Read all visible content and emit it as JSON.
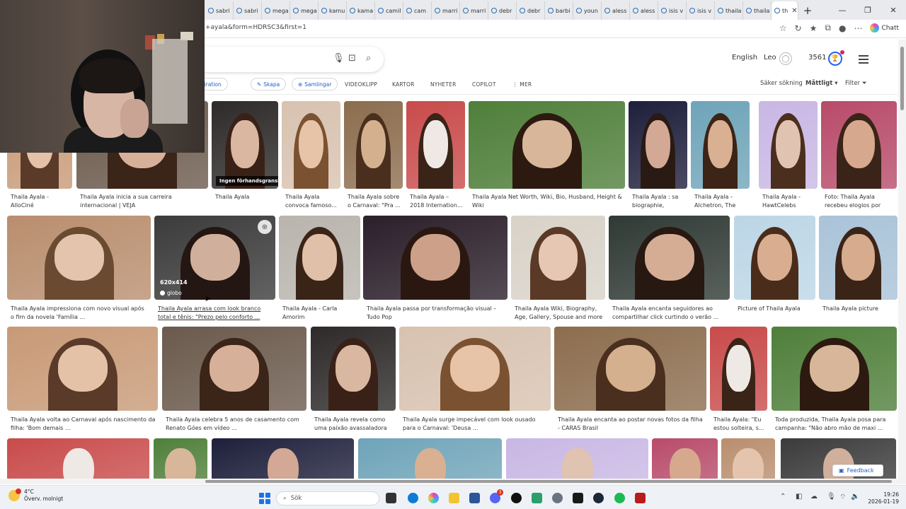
{
  "browser": {
    "tabs": [
      {
        "label": "sabri"
      },
      {
        "label": "sabri"
      },
      {
        "label": "mega"
      },
      {
        "label": "mega"
      },
      {
        "label": "kamu"
      },
      {
        "label": "kama"
      },
      {
        "label": "camil"
      },
      {
        "label": "cam"
      },
      {
        "label": "marri"
      },
      {
        "label": "marri"
      },
      {
        "label": "debr"
      },
      {
        "label": "debr"
      },
      {
        "label": "barbi"
      },
      {
        "label": "youn"
      },
      {
        "label": "aless"
      },
      {
        "label": "aless"
      },
      {
        "label": "isis v"
      },
      {
        "label": "isis v"
      },
      {
        "label": "thaila"
      },
      {
        "label": "thaila"
      },
      {
        "label": "th"
      }
    ],
    "active_tab_close": "✕",
    "new_tab": "+",
    "window_controls": [
      "—",
      "❐",
      "✕"
    ],
    "url": "+ayala&form=HDRSC3&first=1",
    "copilot_label": "Chatt"
  },
  "header": {
    "language": "English",
    "user": "Leo",
    "points": "3561"
  },
  "filters": {
    "chips": [
      "Inspiration",
      "Skapa",
      "Samlingar"
    ],
    "nav": [
      "VIDEOKLIPP",
      "KARTOR",
      "NYHETER",
      "COPILOT",
      "MER"
    ],
    "safe_search": "Säker sökning",
    "safe_level": "Måttligt",
    "filter": "Filter"
  },
  "results": {
    "row1": [
      {
        "caption": "Thaila Ayala - AlloCiné"
      },
      {
        "caption": "Thaila Ayala inicia a sua carreira internacional | VEJA"
      },
      {
        "caption": "Thaila Ayala"
      },
      {
        "caption": "Thaila Ayala convoca famoso..."
      },
      {
        "caption": "Thaila Ayala sobre o Carnaval: \"Pra ..."
      },
      {
        "caption": "Thaila Ayala – 2018 Internation..."
      },
      {
        "caption": "Thaila Ayala Net Worth, Wiki, Bio, Husband, Height & Wiki"
      },
      {
        "caption": "Thaila Ayala : sa biographie, filmo..."
      },
      {
        "caption": "Thaila Ayala - Alchetron, The Fre..."
      },
      {
        "caption": "Thaila Ayala - HawtCelebs"
      },
      {
        "caption": "Foto: Thaila Ayala recebeu elogios por exi..."
      }
    ],
    "row2": [
      {
        "caption": "Thaila Ayala impressiona com novo visual após o fim da novela 'Família ..."
      },
      {
        "caption": "Thaila Ayala arrasa com look branco total e tênis: \"Prezo pelo conforto ..."
      },
      {
        "caption": "Thaila Ayala - Carla Amorim"
      },
      {
        "caption": "Thaila Ayala passa por transformação visual – Tudo Pop"
      },
      {
        "caption": "Thaila Ayala Wiki, Biography, Age, Gallery, Spouse and more"
      },
      {
        "caption": "Thaila Ayala encanta seguidores ao compartilhar click curtindo o verão ..."
      },
      {
        "caption": "Picture of Thaila Ayala"
      },
      {
        "caption": "Thaila Ayala picture"
      }
    ],
    "row3": [
      {
        "caption": "Thaila Ayala volta ao Carnaval após nascimento da filha: 'Bom demais ..."
      },
      {
        "caption": "Thaila Ayala celebra 5 anos de casamento com Renato Góes em vídeo ..."
      },
      {
        "caption": "Thaila Ayala revela como uma paixão avassaladora ..."
      },
      {
        "caption": "Thaila Ayala surge impecável com look ousado para o Carnaval: 'Deusa ..."
      },
      {
        "caption": "Thaila Ayala encanta ao postar novas fotos da filha - CARAS Brasil"
      },
      {
        "caption": "Thaila Ayala: \"Eu estou solteira, s..."
      },
      {
        "caption": "Toda produzida, Thaila Ayala posa para campanha: \"Não abro mão de maxi ..."
      }
    ],
    "preview_badge": "Ingen förhandsgranskning",
    "hover_dims": "620x414",
    "hover_source": "globo"
  },
  "feedback": "Feedback",
  "taskbar": {
    "temp": "4°C",
    "weather": "Överv. molnigt",
    "search": "Sök",
    "chat_badge": "3",
    "time": "19:26",
    "date": "2026-01-19"
  },
  "colors": {
    "accent": "#1f5fc8",
    "rewards": "#2563eb",
    "taskbar": "#eef2f7"
  }
}
